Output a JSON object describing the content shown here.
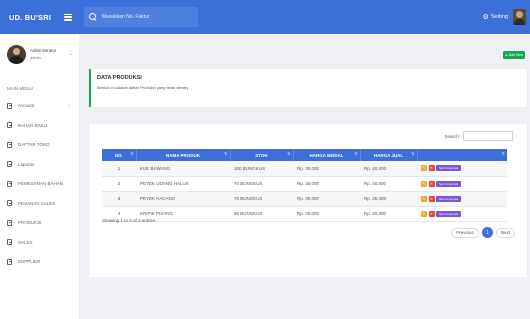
{
  "app": {
    "brand": "UD. BU'SRI"
  },
  "topbar": {
    "search_placeholder": "Masukkan No. Faktur",
    "setting_label": "Setting"
  },
  "user": {
    "name": "Administrator",
    "role": "admin"
  },
  "sidebar": {
    "section_title": "MAIN MENU",
    "items": [
      {
        "label": "Account",
        "has_children": true
      },
      {
        "label": "BAHAN BAKU"
      },
      {
        "label": "DAFTAR TOKO"
      },
      {
        "label": "Laporan"
      },
      {
        "label": "PEMESANAN BAHAN"
      },
      {
        "label": "PESANAN SALES"
      },
      {
        "label": "PRODUKSI"
      },
      {
        "label": "SALES"
      },
      {
        "label": "SUPPLIER"
      }
    ]
  },
  "toolbar": {
    "add_label": "Add New",
    "add_icon": "plus-icon"
  },
  "callout": {
    "title": "DATA PRODUKSI",
    "description": "Berikut ini adalah daftar Produksi yang telah dientry"
  },
  "table": {
    "search_label": "Search:",
    "columns": [
      "NO.",
      "NAMA PRODUK",
      "STOK",
      "HARGA MODAL",
      "HARGA JUAL",
      ""
    ],
    "rows": [
      {
        "no": "1",
        "nama": "KUE BAWANG",
        "stok": "100 BUNGKUS",
        "modal": "Rp. 30,000",
        "jual": "Rp. 40,000"
      },
      {
        "no": "2",
        "nama": "PEYEK UDANG HALUS",
        "stok": "70 BUNGKUS",
        "modal": "Rp. 30,000",
        "jual": "Rp. 40,000"
      },
      {
        "no": "3",
        "nama": "PEYEK KACANG",
        "stok": "70 BUNGKUS",
        "modal": "Rp. 30,000",
        "jual": "Rp. 35,000"
      },
      {
        "no": "4",
        "nama": "KRIPIK PISANG",
        "stok": "80 BUNGKUS",
        "modal": "Rp. 35,000",
        "jual": "Rp. 40,000"
      }
    ],
    "row_actions": {
      "edit_icon": "pencil-icon",
      "delete_icon": "trash-icon",
      "komposisi_label": "Set Komposisi"
    },
    "info": "Showing 1 to 4 of 4 entries"
  },
  "pagination": {
    "previous": "Previous",
    "current": "1",
    "next": "Next"
  },
  "colors": {
    "primary": "#3d6fd8",
    "success": "#19a654",
    "warning": "#f0a733",
    "danger": "#e0483f",
    "purple": "#7b57d6"
  }
}
